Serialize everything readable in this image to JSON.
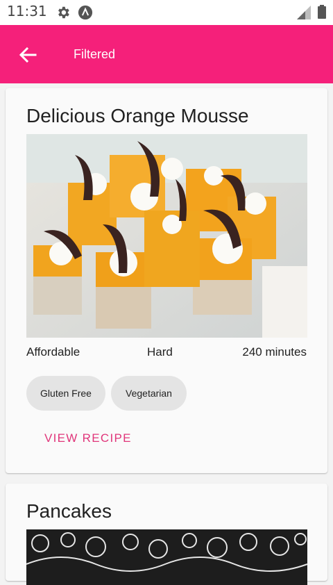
{
  "status_bar": {
    "time": "11:31",
    "icons": [
      "gear-icon",
      "a-logo-icon",
      "signal-icon",
      "battery-icon"
    ]
  },
  "app_bar": {
    "title": "Filtered",
    "back_icon": "arrow-left-icon",
    "color": "#f5207a"
  },
  "recipes": [
    {
      "title": "Delicious Orange Mousse",
      "image": "orange-mousse-photo",
      "affordability": "Affordable",
      "difficulty": "Hard",
      "duration": "240 minutes",
      "tags": [
        "Gluten Free",
        "Vegetarian"
      ],
      "action": "VIEW RECIPE"
    },
    {
      "title": "Pancakes",
      "image": "pancakes-photo"
    }
  ],
  "colors": {
    "accent": "#e0357a",
    "chip_bg": "#e4e4e4",
    "card_bg": "#fafafa"
  }
}
